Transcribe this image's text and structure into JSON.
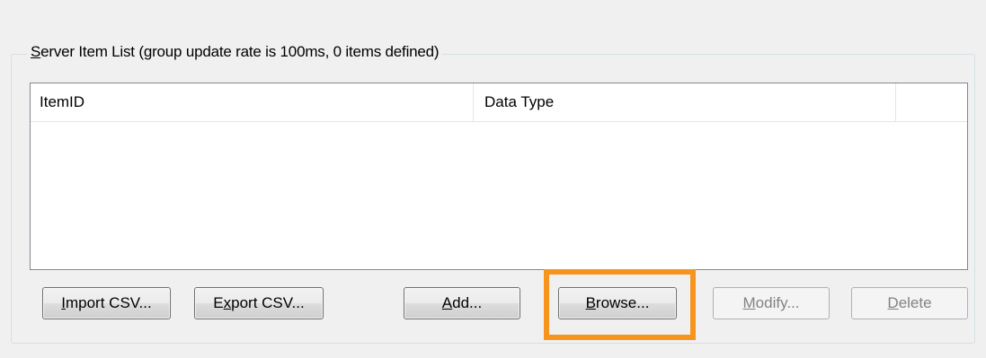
{
  "group": {
    "title_mnemonic": "S",
    "title_rest": "erver Item List (group update rate is 100ms, 0 items defined)"
  },
  "list": {
    "columns": [
      "ItemID",
      "Data Type",
      ""
    ],
    "rows": []
  },
  "buttons": {
    "import": {
      "mnemonic": "I",
      "rest": "mport CSV...",
      "enabled": true
    },
    "export": {
      "pre": "E",
      "mnemonic": "x",
      "rest": "port CSV...",
      "enabled": true
    },
    "add": {
      "mnemonic": "A",
      "rest": "dd...",
      "enabled": true
    },
    "browse": {
      "mnemonic": "B",
      "rest": "rowse...",
      "enabled": true
    },
    "modify": {
      "mnemonic": "M",
      "rest": "odify...",
      "enabled": false
    },
    "delete": {
      "mnemonic": "D",
      "rest": "elete",
      "enabled": false
    }
  },
  "highlight_color": "#f7941d"
}
